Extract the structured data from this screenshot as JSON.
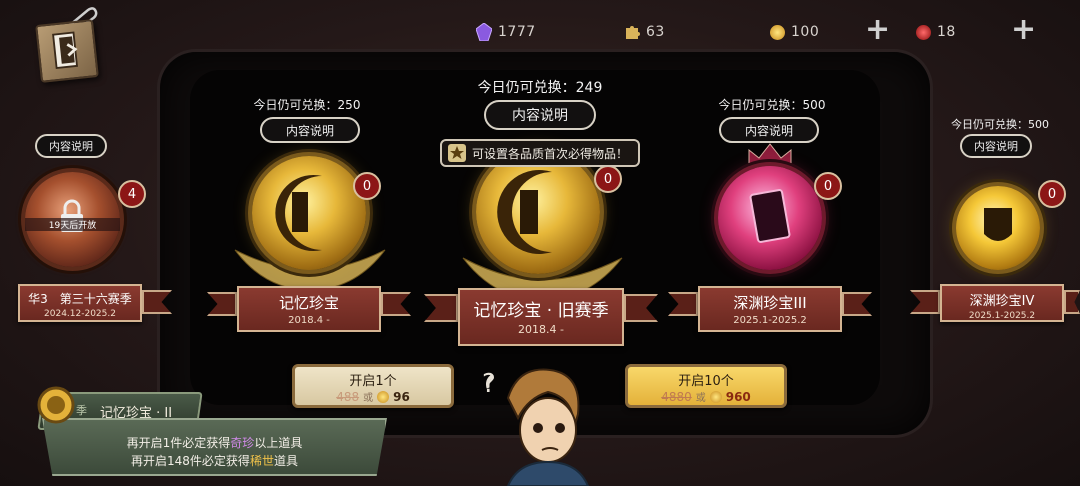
{
  "currencies": [
    {
      "icon": "purple-crystal-icon",
      "value": "1777"
    },
    {
      "icon": "puzzle-piece-icon",
      "value": "63"
    },
    {
      "icon": "gold-coin-icon",
      "value": "100"
    },
    {
      "icon": "red-ruby-icon",
      "value": "18"
    }
  ],
  "plus_label": "+",
  "common": {
    "info_label": "内容说明"
  },
  "cards": {
    "left_edge": {
      "name": "华3　第三十六赛季",
      "date": "2024.12-2025.2",
      "count": "4",
      "lock_text": "19天后开放"
    },
    "memory": {
      "limit": "今日仍可兑换：250",
      "name": "记忆珍宝",
      "date": "2018.4 -",
      "count": "0"
    },
    "memory_old": {
      "limit": "今日仍可兑换：249",
      "name": "记忆珍宝 · 旧赛季",
      "date": "2018.4 -",
      "count": "0"
    },
    "abyss3": {
      "limit": "今日仍可兑换：500",
      "name": "深渊珍宝III",
      "date": "2025.1-2025.2",
      "count": "0"
    },
    "abyss4": {
      "limit": "今日仍可兑换：500",
      "name": "深渊珍宝IV",
      "date": "2025.1-2025.2",
      "count": "0"
    }
  },
  "tooltip": "可设置各品质首次必得物品！",
  "open_buttons": {
    "one": {
      "label": "开启1个",
      "alt_cost": "488",
      "or": "或",
      "cost": "96"
    },
    "ten": {
      "label": "开启10个",
      "alt_cost": "4880",
      "or": "或",
      "cost": "960"
    }
  },
  "pity": {
    "prefix": "季",
    "title": "记忆珍宝 · II",
    "line1_pre": "再开启1件必定获得",
    "line1_hl": "奇珍",
    "line1_post": "以上道具",
    "line2_pre": "再开启148件必定获得",
    "line2_hl": "稀世",
    "line2_post": "道具"
  },
  "colors": {
    "accent_gold": "#e4b23a",
    "ribbon_red": "#7a3028",
    "panel_green": "#4a5a48"
  }
}
